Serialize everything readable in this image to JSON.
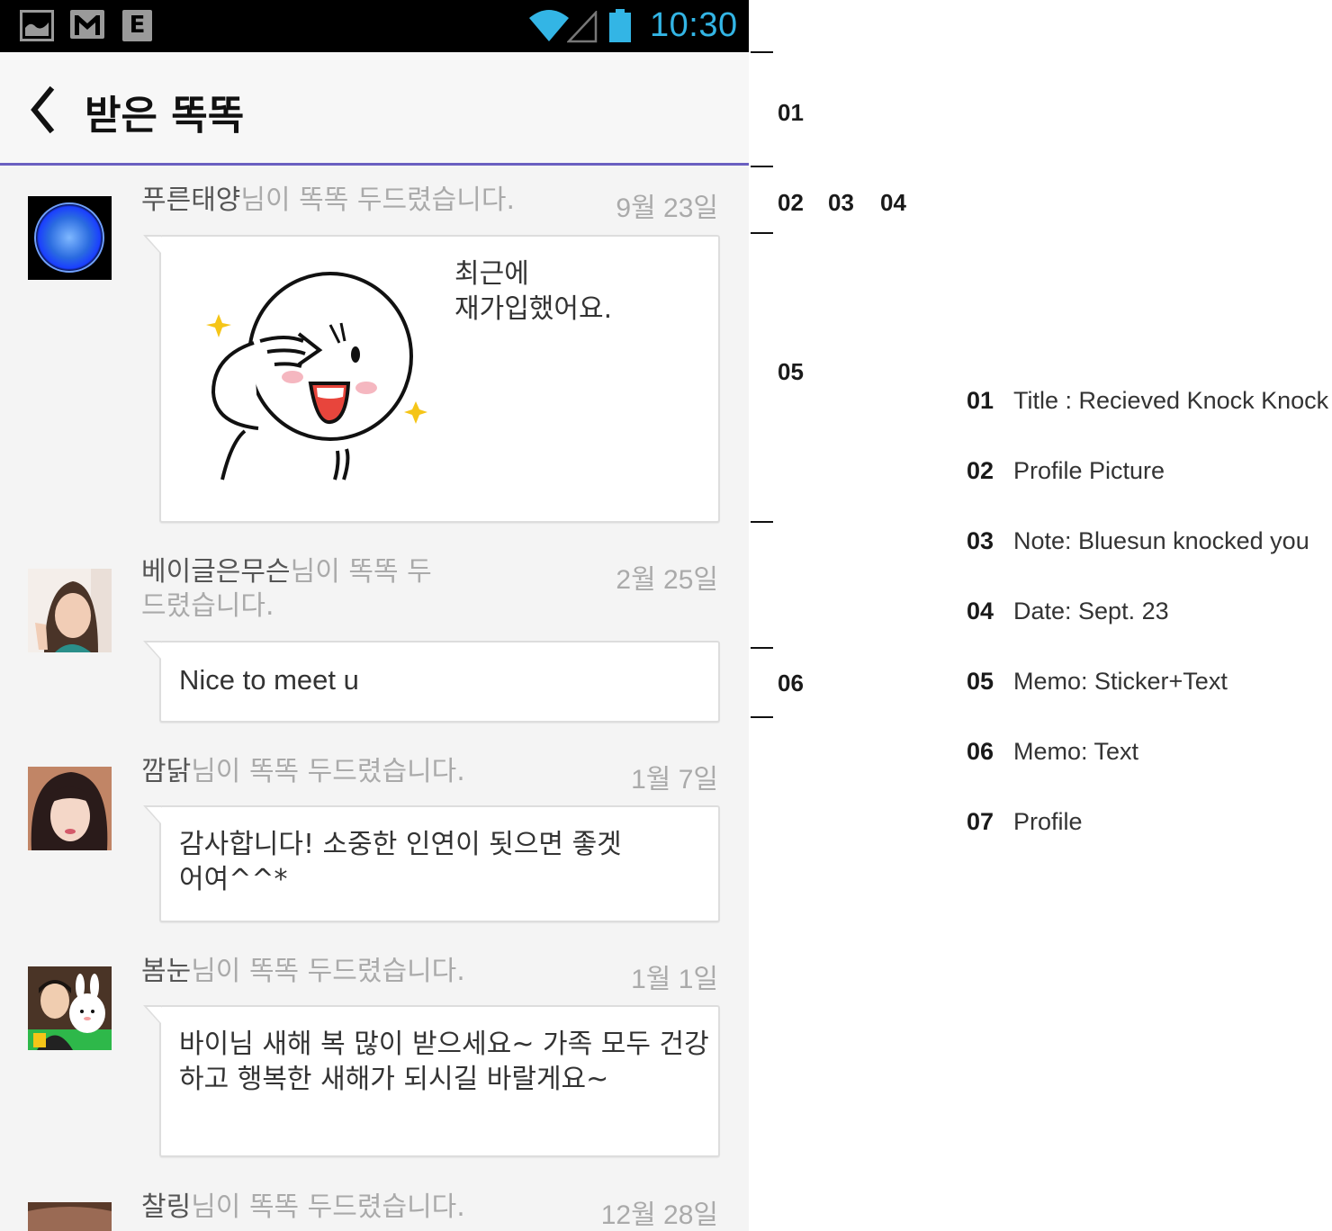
{
  "status_bar": {
    "time": "10:30",
    "notification_icons": [
      "gallery-icon",
      "gmail-icon",
      "edge-e-icon"
    ],
    "indicator_icons": [
      "wifi-icon",
      "signal-icon",
      "battery-icon"
    ],
    "e_glyph": "E",
    "accent_color": "#33b5e5"
  },
  "action_bar": {
    "back_icon": "chevron-left-icon",
    "title": "받은 똑똑",
    "underline_color": "#6a5fc1"
  },
  "entries": [
    {
      "nickname": "푸른태양",
      "suffix": "님이 똑똑 두드렸습니다.",
      "date": "9월 23일",
      "message": "최근에\n재가입했어요.",
      "has_sticker": true,
      "avatar": "blue-sun-avatar"
    },
    {
      "nickname": "베이글은무슨",
      "suffix": "님이 똑똑 두드렸습니다.",
      "date": "2월 25일",
      "message": "Nice to meet u",
      "avatar": "woman-peace-sign-avatar"
    },
    {
      "nickname": "깜닭",
      "suffix": "님이 똑똑 두드렸습니다.",
      "date": "1월 7일",
      "message": "감사합니다! 소중한 인연이 됫으면 좋겟어여^^*",
      "avatar": "woman-selfie-avatar"
    },
    {
      "nickname": "봄눈",
      "suffix": "님이 똑똑 두드렸습니다.",
      "date": "1월 1일",
      "message": "바이님 새해 복 많이 받으세요~ 가족 모두 건강하고 행복한 새해가 되시길 바랄게요~",
      "avatar": "boy-with-bunny-avatar"
    },
    {
      "nickname": "찰링",
      "suffix": "님이 똑똑 두드렸습니다.",
      "date": "12월 28일",
      "avatar": "partial-avatar"
    }
  ],
  "annotations": {
    "markers": [
      "01",
      "02",
      "03",
      "04",
      "05",
      "06"
    ],
    "legend": [
      {
        "num": "01",
        "text": "Title : Recieved Knock Knock"
      },
      {
        "num": "02",
        "text": "Profile Picture"
      },
      {
        "num": "03",
        "text": "Note: Bluesun knocked you"
      },
      {
        "num": "04",
        "text": "Date: Sept. 23"
      },
      {
        "num": "05",
        "text": "Memo: Sticker+Text"
      },
      {
        "num": "06",
        "text": "Memo: Text"
      },
      {
        "num": "07",
        "text": "Profile"
      }
    ]
  }
}
